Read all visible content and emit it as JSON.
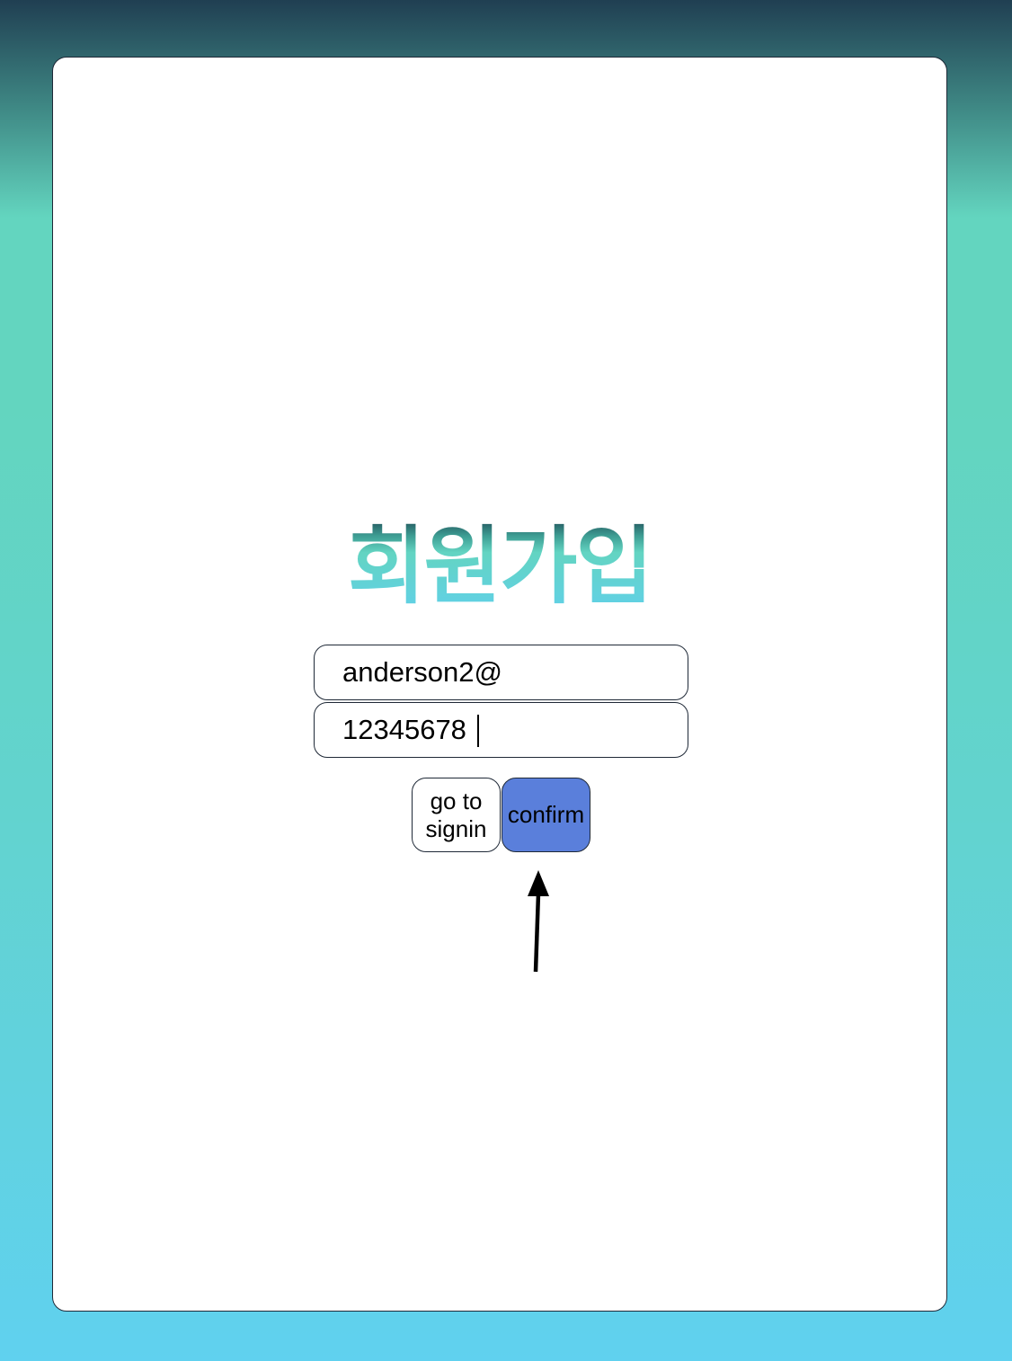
{
  "signup": {
    "title": "회원가입",
    "email_value": "anderson2@",
    "password_value": "12345678",
    "buttons": {
      "signin_label": "go to signin",
      "confirm_label": "confirm"
    }
  },
  "colors": {
    "confirm_button": "#5a7fdb",
    "title_gradient_top": "#1f4a55",
    "title_gradient_bottom": "#60d0ea"
  },
  "annotation": {
    "arrow_icon": "up-arrow-icon"
  }
}
